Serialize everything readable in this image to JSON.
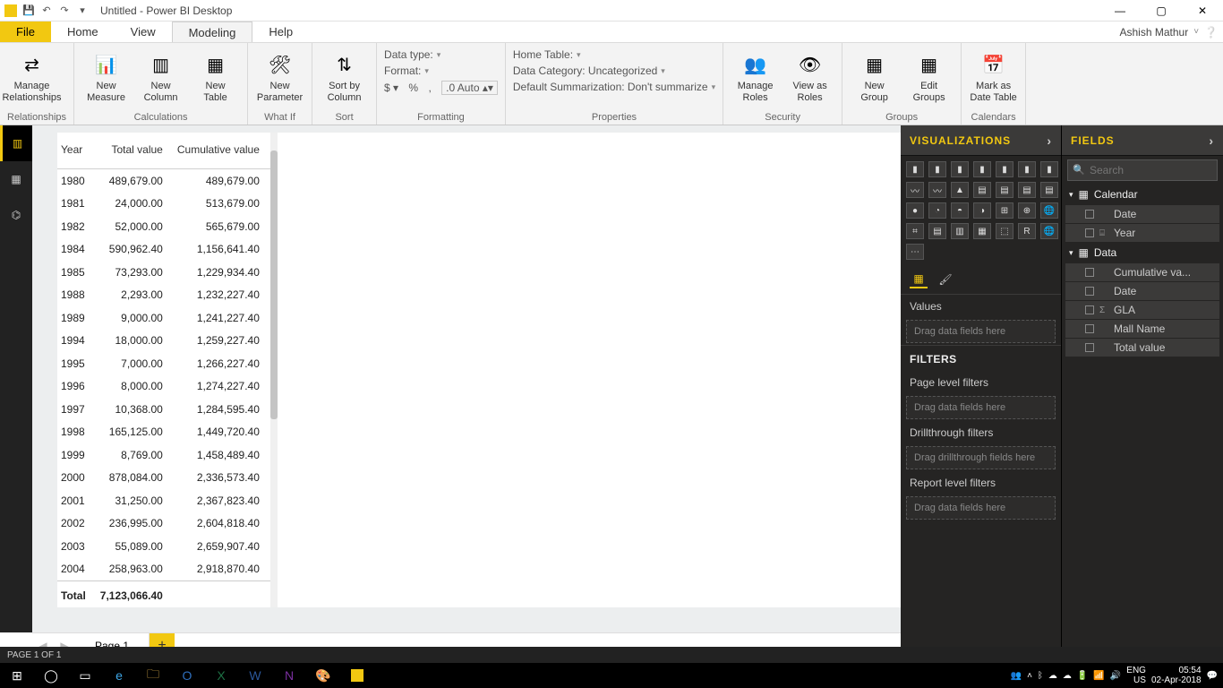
{
  "titlebar": {
    "title": "Untitled - Power BI Desktop"
  },
  "menubar": {
    "file": "File",
    "tabs": [
      "Home",
      "View",
      "Modeling",
      "Help"
    ],
    "active_index": 2,
    "user": "Ashish Mathur"
  },
  "ribbon": {
    "relationships": {
      "label": "Relationships",
      "manage": "Manage\nRelationships"
    },
    "calculations": {
      "label": "Calculations",
      "new_measure": "New\nMeasure",
      "new_column": "New\nColumn",
      "new_table": "New\nTable"
    },
    "whatif": {
      "label": "What If",
      "new_parameter": "New\nParameter"
    },
    "sort": {
      "label": "Sort",
      "sort_by_column": "Sort by\nColumn"
    },
    "formatting": {
      "label": "Formatting",
      "data_type": "Data type:",
      "format": "Format:",
      "currency": "$",
      "pct": "%",
      "comma": ",",
      "decimals": "Auto"
    },
    "properties": {
      "label": "Properties",
      "home_table": "Home Table:",
      "data_category": "Data Category: Uncategorized",
      "default_summarization": "Default Summarization: Don't summarize"
    },
    "security": {
      "label": "Security",
      "manage_roles": "Manage\nRoles",
      "view_as_roles": "View as\nRoles"
    },
    "groups": {
      "label": "Groups",
      "new_group": "New\nGroup",
      "edit_groups": "Edit\nGroups"
    },
    "calendars": {
      "label": "Calendars",
      "mark_as": "Mark as\nDate Table"
    }
  },
  "table": {
    "columns": [
      "Year",
      "Total value",
      "Cumulative value"
    ],
    "rows": [
      [
        "1980",
        "489,679.00",
        "489,679.00"
      ],
      [
        "1981",
        "24,000.00",
        "513,679.00"
      ],
      [
        "1982",
        "52,000.00",
        "565,679.00"
      ],
      [
        "1984",
        "590,962.40",
        "1,156,641.40"
      ],
      [
        "1985",
        "73,293.00",
        "1,229,934.40"
      ],
      [
        "1988",
        "2,293.00",
        "1,232,227.40"
      ],
      [
        "1989",
        "9,000.00",
        "1,241,227.40"
      ],
      [
        "1994",
        "18,000.00",
        "1,259,227.40"
      ],
      [
        "1995",
        "7,000.00",
        "1,266,227.40"
      ],
      [
        "1996",
        "8,000.00",
        "1,274,227.40"
      ],
      [
        "1997",
        "10,368.00",
        "1,284,595.40"
      ],
      [
        "1998",
        "165,125.00",
        "1,449,720.40"
      ],
      [
        "1999",
        "8,769.00",
        "1,458,489.40"
      ],
      [
        "2000",
        "878,084.00",
        "2,336,573.40"
      ],
      [
        "2001",
        "31,250.00",
        "2,367,823.40"
      ],
      [
        "2002",
        "236,995.00",
        "2,604,818.40"
      ],
      [
        "2003",
        "55,089.00",
        "2,659,907.40"
      ],
      [
        "2004",
        "258,963.00",
        "2,918,870.40"
      ]
    ],
    "total_label": "Total",
    "total_value": "7,123,066.40"
  },
  "pagetabs": {
    "page1": "Page 1"
  },
  "statusbar": {
    "text": "PAGE 1 OF 1"
  },
  "viz_pane": {
    "header": "VISUALIZATIONS",
    "values_label": "Values",
    "drag_here": "Drag data fields here",
    "filters_header": "FILTERS",
    "page_filters": "Page level filters",
    "drag_data": "Drag data fields here",
    "drillthrough": "Drillthrough filters",
    "drag_drill": "Drag drillthrough fields here",
    "report_filters": "Report level filters",
    "drag_report": "Drag data fields here"
  },
  "fields_pane": {
    "header": "FIELDS",
    "search_placeholder": "Search",
    "tables": [
      {
        "name": "Calendar",
        "fields": [
          {
            "name": "Date",
            "icon": ""
          },
          {
            "name": "Year",
            "icon": "⌸"
          }
        ]
      },
      {
        "name": "Data",
        "fields": [
          {
            "name": "Cumulative va...",
            "icon": ""
          },
          {
            "name": "Date",
            "icon": ""
          },
          {
            "name": "GLA",
            "icon": "Σ"
          },
          {
            "name": "Mall Name",
            "icon": ""
          },
          {
            "name": "Total value",
            "icon": ""
          }
        ]
      }
    ]
  },
  "taskbar": {
    "lang1": "ENG",
    "lang2": "US",
    "time": "05:54",
    "date": "02-Apr-2018"
  }
}
